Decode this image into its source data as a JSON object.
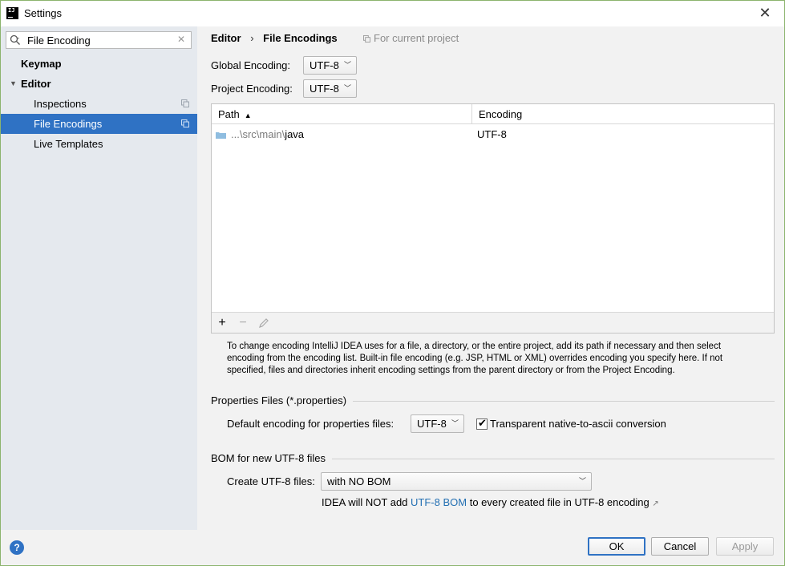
{
  "window": {
    "title": "Settings",
    "app_icon_label": "IJ"
  },
  "sidebar": {
    "search_value": "File Encoding",
    "items": [
      {
        "label": "Keymap"
      },
      {
        "label": "Editor"
      },
      {
        "label": "Inspections"
      },
      {
        "label": "File Encodings"
      },
      {
        "label": "Live Templates"
      }
    ]
  },
  "breadcrumb": {
    "parent": "Editor",
    "separator": "›",
    "current": "File Encodings",
    "scope": "For current project"
  },
  "global_encoding": {
    "label": "Global Encoding:",
    "value": "UTF-8"
  },
  "project_encoding": {
    "label": "Project Encoding:",
    "value": "UTF-8"
  },
  "table": {
    "headers": {
      "path": "Path",
      "encoding": "Encoding"
    },
    "rows": [
      {
        "path_prefix": "...\\src\\main\\",
        "path_leaf": "java",
        "encoding": "UTF-8"
      }
    ],
    "toolbar": {
      "add": "+",
      "remove": "−"
    }
  },
  "help_text": "To change encoding IntelliJ IDEA uses for a file, a directory, or the entire project, add its path if necessary and then select encoding from the encoding list. Built-in file encoding (e.g. JSP, HTML or XML) overrides encoding you specify here. If not specified, files and directories inherit encoding settings from the parent directory or from the Project Encoding.",
  "properties": {
    "section_title": "Properties Files (*.properties)",
    "default_label": "Default encoding for properties files:",
    "default_value": "UTF-8",
    "transparent_label": "Transparent native-to-ascii conversion",
    "transparent_checked": true
  },
  "bom": {
    "section_title": "BOM for new UTF-8 files",
    "create_label": "Create UTF-8 files:",
    "create_value": "with NO BOM",
    "info_prefix": "IDEA will NOT add ",
    "info_link": "UTF-8 BOM",
    "info_suffix": " to every created file in UTF-8 encoding",
    "info_arrow": "↗"
  },
  "buttons": {
    "ok": "OK",
    "cancel": "Cancel",
    "apply": "Apply",
    "help": "?"
  },
  "colors": {
    "accent": "#2f72c4",
    "link": "#2470b3",
    "window_border": "#8cb46e"
  }
}
